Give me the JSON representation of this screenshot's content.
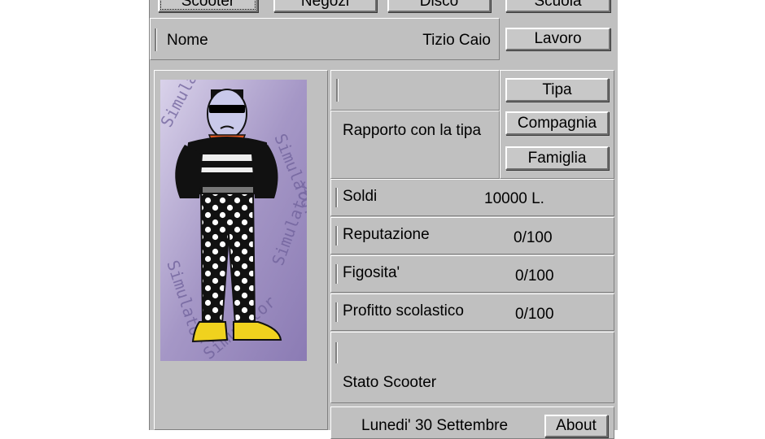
{
  "top_buttons": [
    "Scooter",
    "Negozi",
    "Disco",
    "Scuola"
  ],
  "profile": {
    "name_label": "Nome",
    "name_value": "Tizio Caio"
  },
  "side_buttons": {
    "lavoro": "Lavoro",
    "tipa": "Tipa",
    "compagnia": "Compagnia",
    "famiglia": "Famiglia"
  },
  "relationship": {
    "label": "Rapporto con la tipa"
  },
  "stats": [
    {
      "label": "Soldi",
      "value": "10000 L."
    },
    {
      "label": "Reputazione",
      "value": "0/100"
    },
    {
      "label": "Figosita'",
      "value": "0/100"
    },
    {
      "label": "Profitto scolastico",
      "value": "0/100"
    }
  ],
  "scooter_status": {
    "label": "Stato Scooter"
  },
  "footer": {
    "date": "Lunedi' 30 Settembre",
    "about_label": "About"
  },
  "portrait": {
    "background_text": "Simulator",
    "icon": "character-portrait"
  },
  "colors": {
    "window_bg": "#c0c0c0",
    "portrait_bg": "#a89ac4"
  }
}
